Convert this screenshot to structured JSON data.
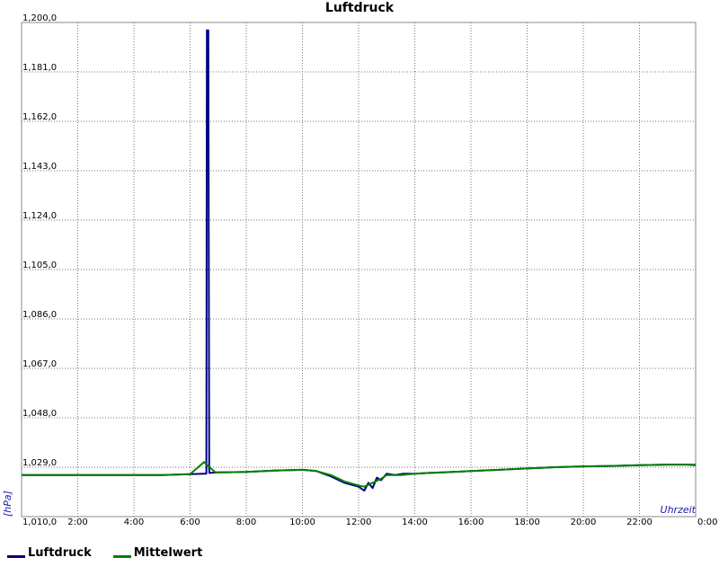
{
  "chart_data": {
    "type": "line",
    "title": "Luftdruck",
    "xlabel": "Uhrzeit",
    "ylabel": "[hPa]",
    "x_ticks": [
      "2:00",
      "4:00",
      "6:00",
      "8:00",
      "10:00",
      "12:00",
      "14:00",
      "16:00",
      "18:00",
      "20:00",
      "22:00",
      "0:00"
    ],
    "y_ticks": [
      "1,010,0",
      "1,029,0",
      "1,048,0",
      "1,067,0",
      "1,086,0",
      "1,105,0",
      "1,124,0",
      "1,143,0",
      "1,162,0",
      "1,181,0",
      "1,200,0"
    ],
    "xlim": [
      0,
      24
    ],
    "ylim": [
      1010,
      1200
    ],
    "grid": true,
    "legend_position": "bottom-left",
    "series": [
      {
        "name": "Luftdruck",
        "color": "#000080",
        "points": [
          [
            0,
            1026
          ],
          [
            2,
            1026
          ],
          [
            3,
            1026
          ],
          [
            4,
            1026
          ],
          [
            5,
            1026
          ],
          [
            6,
            1026.3
          ],
          [
            6.5,
            1026.5
          ],
          [
            6.58,
            1026.5
          ],
          [
            6.6,
            1197
          ],
          [
            6.65,
            1197
          ],
          [
            6.68,
            1026.8
          ],
          [
            7,
            1027
          ],
          [
            8,
            1027.2
          ],
          [
            9,
            1027.7
          ],
          [
            10,
            1028
          ],
          [
            10.5,
            1027.5
          ],
          [
            11,
            1025.5
          ],
          [
            11.5,
            1023
          ],
          [
            12,
            1021.5
          ],
          [
            12.2,
            1020
          ],
          [
            12.35,
            1023
          ],
          [
            12.5,
            1021
          ],
          [
            12.65,
            1025
          ],
          [
            12.8,
            1024
          ],
          [
            13,
            1026.5
          ],
          [
            13.3,
            1026
          ],
          [
            13.6,
            1026.5
          ],
          [
            14,
            1026.5
          ],
          [
            14.5,
            1026.8
          ],
          [
            15,
            1027
          ],
          [
            16,
            1027.5
          ],
          [
            17,
            1028
          ],
          [
            18,
            1028.5
          ],
          [
            19,
            1029
          ],
          [
            20,
            1029.3
          ],
          [
            21,
            1029.5
          ],
          [
            22,
            1029.8
          ],
          [
            23,
            1030
          ],
          [
            23.7,
            1030
          ],
          [
            24,
            1029.8
          ]
        ]
      },
      {
        "name": "Mittelwert",
        "color": "#008000",
        "points": [
          [
            0,
            1026
          ],
          [
            2,
            1026
          ],
          [
            3,
            1026
          ],
          [
            4,
            1026
          ],
          [
            5,
            1026
          ],
          [
            6,
            1026.3
          ],
          [
            6.5,
            1031
          ],
          [
            6.9,
            1027
          ],
          [
            7,
            1027
          ],
          [
            8,
            1027.2
          ],
          [
            9,
            1027.7
          ],
          [
            10,
            1028
          ],
          [
            10.5,
            1027.5
          ],
          [
            11,
            1026
          ],
          [
            11.5,
            1023.5
          ],
          [
            12,
            1022
          ],
          [
            12.2,
            1021.5
          ],
          [
            12.4,
            1022.5
          ],
          [
            12.6,
            1023.5
          ],
          [
            12.8,
            1024.5
          ],
          [
            13,
            1026
          ],
          [
            13.5,
            1026
          ],
          [
            14,
            1026.5
          ],
          [
            14.5,
            1026.8
          ],
          [
            15,
            1027
          ],
          [
            16,
            1027.5
          ],
          [
            17,
            1028
          ],
          [
            18,
            1028.5
          ],
          [
            19,
            1029
          ],
          [
            20,
            1029.3
          ],
          [
            21,
            1029.5
          ],
          [
            22,
            1029.8
          ],
          [
            23,
            1030
          ],
          [
            24,
            1030
          ]
        ]
      }
    ]
  }
}
